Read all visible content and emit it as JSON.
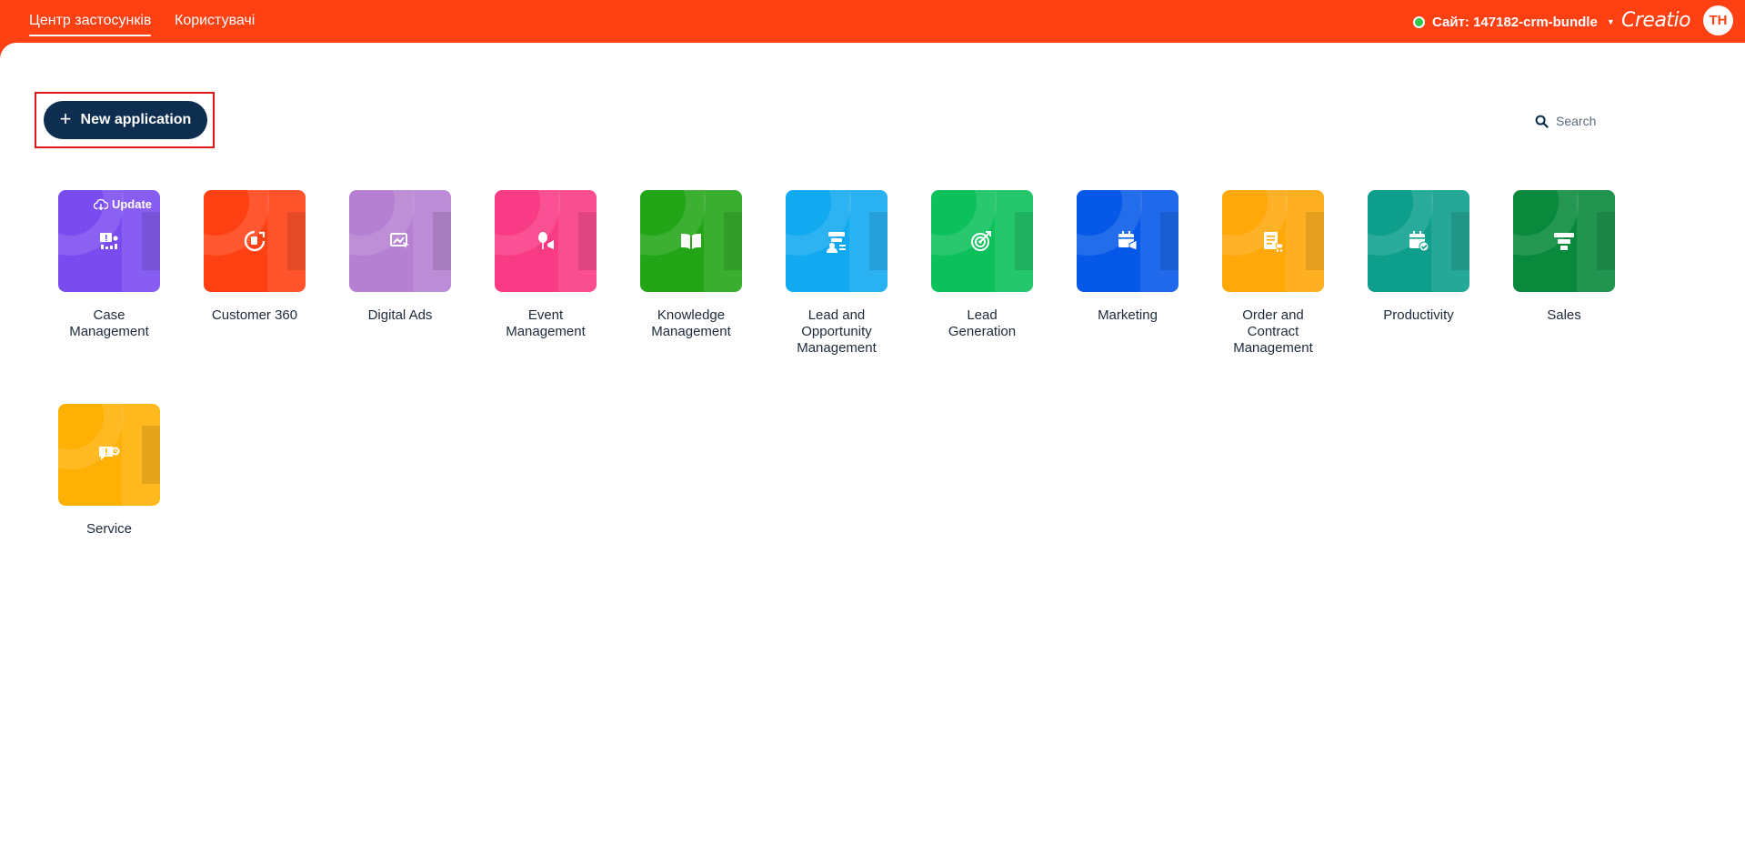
{
  "nav": {
    "tabs": [
      {
        "label": "Центр застосунків",
        "active": true
      },
      {
        "label": "Користувачі",
        "active": false
      }
    ]
  },
  "header": {
    "site_label": "Сайт: 147182-crm-bundle",
    "site_status_color": "#2cc84d",
    "brand": "Creatio",
    "avatar_initials": "TH"
  },
  "toolbar": {
    "new_app_label": "New application",
    "search_placeholder": "Search"
  },
  "colors": {
    "topbar": "#ff4013",
    "primary_button": "#0d2e4e",
    "highlight": "#e3161b"
  },
  "apps": [
    {
      "label": "Case\nManagement",
      "color": "#7a4cf0",
      "icon": "case-icon",
      "badge": "Update"
    },
    {
      "label": "Customer 360",
      "color": "#ff4013",
      "icon": "customer-360-icon"
    },
    {
      "label": "Digital Ads",
      "color": "#b57fd2",
      "icon": "digital-ads-icon"
    },
    {
      "label": "Event\nManagement",
      "color": "#f93a84",
      "icon": "event-icon"
    },
    {
      "label": "Knowledge\nManagement",
      "color": "#23a518",
      "icon": "book-icon"
    },
    {
      "label": "Lead and\nOpportunity\nManagement",
      "color": "#11a9f0",
      "icon": "lead-opportunity-icon"
    },
    {
      "label": "Lead\nGeneration",
      "color": "#0cc15b",
      "icon": "target-icon"
    },
    {
      "label": "Marketing",
      "color": "#0659e8",
      "icon": "marketing-icon"
    },
    {
      "label": "Order and\nContract\nManagement",
      "color": "#ffa80a",
      "icon": "order-icon"
    },
    {
      "label": "Productivity",
      "color": "#0d9f8c",
      "icon": "calendar-check-icon"
    },
    {
      "label": "Sales",
      "color": "#08893b",
      "icon": "funnel-icon"
    },
    {
      "label": "Service",
      "color": "#ffb004",
      "icon": "service-icon"
    }
  ]
}
